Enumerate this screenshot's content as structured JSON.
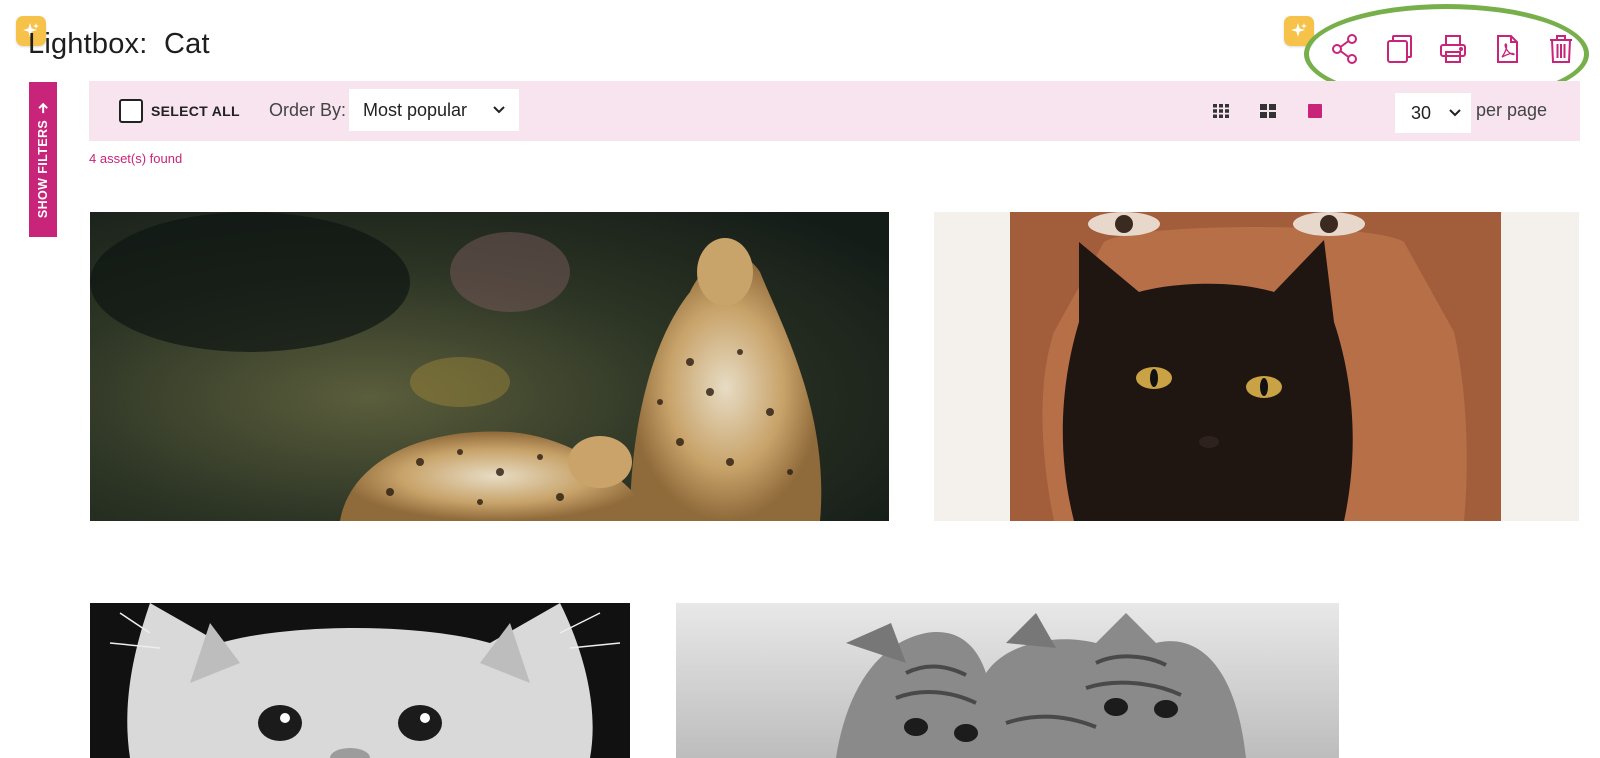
{
  "page": {
    "title": "Lightbox:  Cat"
  },
  "header_actions": [
    {
      "name": "share",
      "icon": "share-icon"
    },
    {
      "name": "copy",
      "icon": "copy-icon"
    },
    {
      "name": "print",
      "icon": "print-icon"
    },
    {
      "name": "pdf",
      "icon": "pdf-icon"
    },
    {
      "name": "delete",
      "icon": "trash-icon"
    }
  ],
  "sidebar": {
    "show_filters_label": "SHOW FILTERS"
  },
  "toolbar": {
    "select_all_label": "SELECT ALL",
    "select_all_checked": false,
    "order_by_label": "Order By:",
    "order_by_value": "Most popular",
    "view_modes": [
      "small-grid-icon",
      "medium-grid-icon",
      "large-grid-icon"
    ],
    "active_view_mode": "large-grid-icon",
    "per_page_value": "30",
    "per_page_label": "per page"
  },
  "results": {
    "found_text": "4 asset(s) found"
  },
  "assets": [
    {
      "name": "asset-leopards-painting"
    },
    {
      "name": "asset-black-cat-face"
    },
    {
      "name": "asset-white-kitten"
    },
    {
      "name": "asset-tabby-kittens"
    }
  ],
  "colors": {
    "accent": "#c8247a",
    "toolbar_bg": "#f8e4ef",
    "highlight_ring": "#77b04b",
    "sparkle": "#f6c24a"
  }
}
